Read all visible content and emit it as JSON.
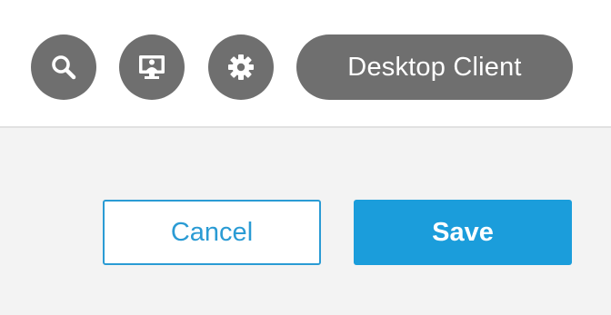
{
  "toolbar": {
    "icons": [
      {
        "name": "search-icon",
        "glyph": "magnifier"
      },
      {
        "name": "screen-share-icon",
        "glyph": "monitor-with-person"
      },
      {
        "name": "gear-icon",
        "glyph": "cog"
      }
    ],
    "client_button_label": "Desktop Client",
    "button_color": "#6f6f6f"
  },
  "footer": {
    "cancel_label": "Cancel",
    "save_label": "Save",
    "accent_color": "#1b9ddb",
    "background_color": "#f3f3f3"
  }
}
